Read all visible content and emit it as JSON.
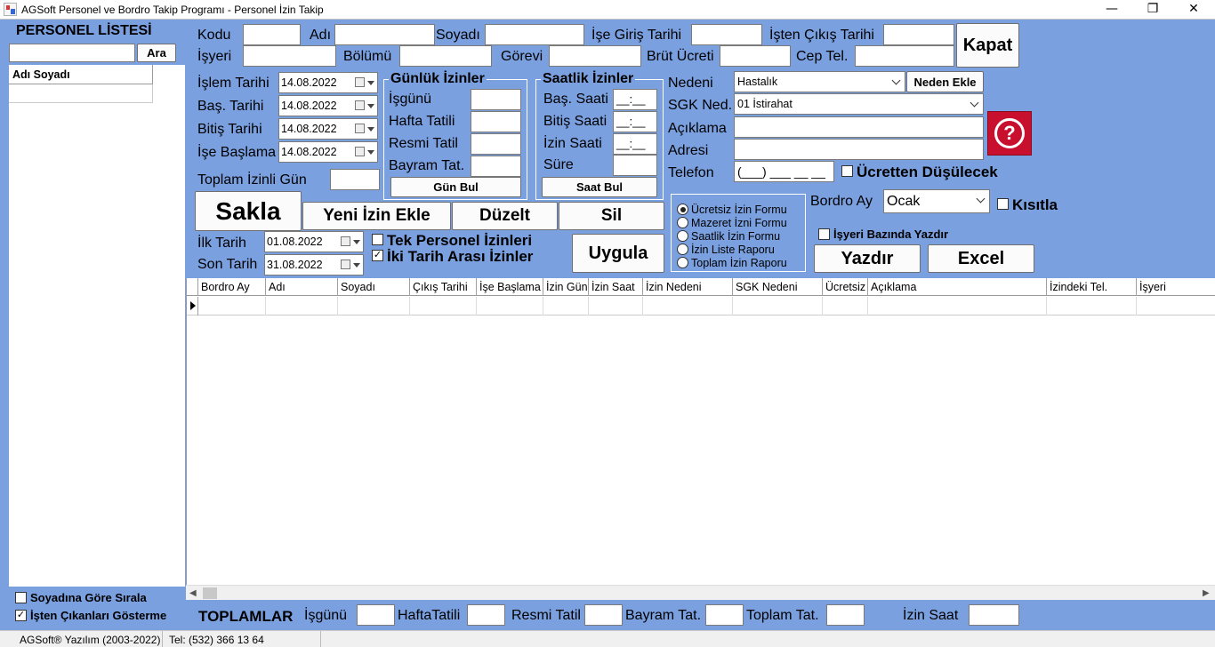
{
  "window": {
    "title": "AGSoft Personel ve Bordro Takip Programı - Personel İzin Takip",
    "minimize": "—",
    "restore": "❐",
    "close": "✕"
  },
  "sidebar": {
    "title": "PERSONEL LİSTESİ",
    "search_button": "Ara",
    "list_header": "Adı Soyadı",
    "sort_by_surname": "Soyadına Göre Sırala",
    "hide_leavers": "İşten Çıkanları Gösterme",
    "hide_leavers_checked": true
  },
  "form": {
    "kodu": "Kodu",
    "adi": "Adı",
    "soyadi": "Soyadı",
    "ise_giris": "İşe Giriş Tarihi",
    "isten_cikis": "İşten Çıkış Tarihi",
    "isyeri": "İşyeri",
    "bolumu": "Bölümü",
    "gorevi": "Görevi",
    "brut_ucreti": "Brüt Ücreti",
    "cep_tel": "Cep Tel.",
    "kapat": "Kapat"
  },
  "dates": {
    "islem_label": "İşlem Tarihi",
    "islem_value": "14.08.2022",
    "bas_label": "Baş. Tarihi",
    "bas_value": "14.08.2022",
    "bitis_label": "Bitiş Tarihi",
    "bitis_value": "14.08.2022",
    "ise_baslama_label": "İşe Başlama",
    "ise_baslama_value": "14.08.2022",
    "toplam_izinli_gun": "Toplam İzinli Gün"
  },
  "daily": {
    "title": "Günlük İzinler",
    "isgunu": "İşgünü",
    "hafta_tatili": "Hafta Tatili",
    "resmi_tatil": "Resmi Tatil",
    "bayram_tat": "Bayram Tat.",
    "gun_bul": "Gün Bul"
  },
  "hourly": {
    "title": "Saatlik İzinler",
    "bas_saati": "Baş. Saati",
    "bitis_saati": "Bitiş Saati",
    "izin_saati": "İzin Saati",
    "sure": "Süre",
    "mask": "__:__",
    "saat_bul": "Saat Bul"
  },
  "reason": {
    "nedeni_label": "Nedeni",
    "nedeni_value": "Hastalık",
    "neden_ekle": "Neden Ekle",
    "sgk_label": "SGK Ned.",
    "sgk_value": "01 İstirahat",
    "aciklama_label": "Açıklama",
    "adresi_label": "Adresi",
    "telefon_label": "Telefon",
    "telefon_mask": "(___) ___ __ __",
    "ucretten": "Ücretten Düşülecek",
    "help_icon_glyph": "?"
  },
  "actions": {
    "sakla": "Sakla",
    "yeni": "Yeni İzin Ekle",
    "duzelt": "Düzelt",
    "sil": "Sil",
    "uygula": "Uygula"
  },
  "filter": {
    "ilk_label": "İlk Tarih",
    "ilk_value": "01.08.2022",
    "son_label": "Son Tarih",
    "son_value": "31.08.2022",
    "tek_personel": "Tek Personel İzinleri",
    "tek_personel_checked": false,
    "iki_tarih": "İki Tarih Arası İzinler",
    "iki_tarih_checked": true
  },
  "reports": {
    "options": [
      "Ücretsiz İzin Formu",
      "Mazeret İzni Formu",
      "Saatlik İzin Formu",
      "İzin Liste Raporu",
      "Toplam İzin Raporu"
    ],
    "selected": 0,
    "bordro_ay_label": "Bordro Ay",
    "bordro_ay_value": "Ocak",
    "kisitla": "Kısıtla",
    "isyeri_bazinda": "İşyeri Bazında Yazdır",
    "yazdir": "Yazdır",
    "excel": "Excel"
  },
  "grid": {
    "columns": [
      "Bordro Ay",
      "Adı",
      "Soyadı",
      "Çıkış Tarihi",
      "İşe Başlama",
      "İzin Gün",
      "İzin Saat",
      "İzin Nedeni",
      "SGK Nedeni",
      "Ücretsiz",
      "Açıklama",
      "İzindeki Tel.",
      "İşyeri"
    ]
  },
  "totals": {
    "title": "TOPLAMLAR",
    "isgunu": "İşgünü",
    "hafta_tatili": "HaftaTatili",
    "resmi_tatil": "Resmi Tatil",
    "bayram_tat": "Bayram Tat.",
    "toplam_tat": "Toplam Tat.",
    "izin_saat": "İzin Saat"
  },
  "status": {
    "company": "AGSoft® Yazılım (2003-2022)",
    "phone": "Tel: (532) 366 13 64"
  },
  "colors": {
    "background": "#7aa0e0",
    "help_red": "#c8102e"
  }
}
